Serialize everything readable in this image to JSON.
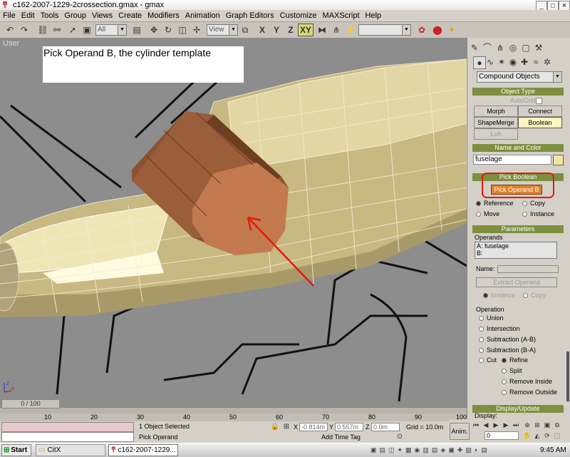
{
  "window": {
    "title": "c162-2007-1229-2crossection.gmax - gmax",
    "min": "_",
    "max": "□",
    "close": "×"
  },
  "menu": [
    "File",
    "Edit",
    "Tools",
    "Group",
    "Views",
    "Create",
    "Modifiers",
    "Animation",
    "Graph Editors",
    "Customize",
    "MAXScript",
    "Help"
  ],
  "toolbar": {
    "selection_filter": "All",
    "coordinate_system": "View",
    "axis_x": "X",
    "axis_y": "Y",
    "axis_z": "Z",
    "axis_xy": "XY",
    "named_selection": ""
  },
  "viewport": {
    "label": "User",
    "callout": "Pick Operand B, the cylinder template",
    "annotation_color": "#e8180c"
  },
  "panel": {
    "category": "Compound Objects",
    "object_type": {
      "header": "Object Type",
      "autogrid": "AutoGrid",
      "buttons": [
        "Morph",
        "Connect",
        "ShapeMerge",
        "Boolean",
        "Loft"
      ]
    },
    "name_color": {
      "header": "Name and Color",
      "name": "fuselage",
      "swatch": "#f0e6a0"
    },
    "pick_boolean": {
      "header": "Pick Boolean",
      "button": "Pick Operand B",
      "options": [
        "Reference",
        "Copy",
        "Move",
        "Instance"
      ]
    },
    "parameters": {
      "header": "Parameters",
      "operands_label": "Operands",
      "operands": [
        "A: fuselage",
        "B:"
      ],
      "name_label": "Name:",
      "extract": "Extract Operand",
      "instance": "Instance",
      "copy": "Copy"
    },
    "operation": {
      "label": "Operation",
      "items": [
        "Union",
        "Intersection",
        "Subtraction (A-B)",
        "Subtraction (B-A)",
        "Cut"
      ],
      "cut_options": [
        "Refine",
        "Split",
        "Remove Inside",
        "Remove Outside"
      ]
    },
    "display": {
      "header": "Display/Update",
      "display_label": "Display:"
    }
  },
  "timeline": {
    "frame": "0 / 100",
    "ticks": [
      "10",
      "20",
      "30",
      "40",
      "50",
      "60",
      "70",
      "80",
      "90",
      "100"
    ]
  },
  "status": {
    "selection": "1 Object Selected",
    "prompt": "Pick Operand",
    "x_label": "X",
    "x": "-0.814m",
    "y_label": "Y",
    "y": "0.557m",
    "z_label": "Z",
    "z": "0.0m",
    "grid": "Grid = 10.0m",
    "add_time_tag": "Add Time Tag",
    "anim": "Anim.",
    "frame_field": "0"
  },
  "taskbar": {
    "start": "Start",
    "task1": "CitX",
    "task2": "c162-2007-1229...",
    "clock": "9:45 AM"
  }
}
